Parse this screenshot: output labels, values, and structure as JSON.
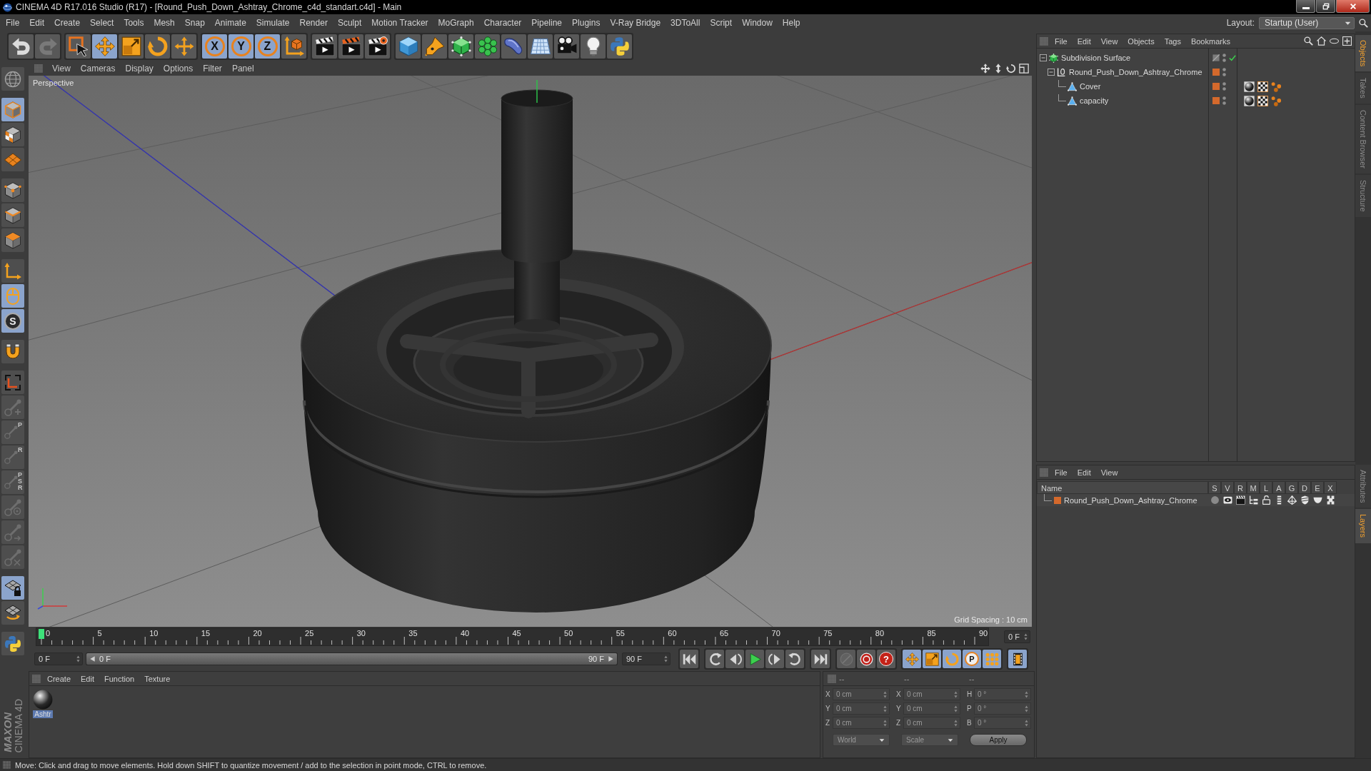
{
  "window": {
    "title": "CINEMA 4D R17.016 Studio (R17) - [Round_Push_Down_Ashtray_Chrome_c4d_standart.c4d] - Main"
  },
  "menu_bar": {
    "items": [
      "File",
      "Edit",
      "Create",
      "Select",
      "Tools",
      "Mesh",
      "Snap",
      "Animate",
      "Simulate",
      "Render",
      "Sculpt",
      "Motion Tracker",
      "MoGraph",
      "Character",
      "Pipeline",
      "Plugins",
      "V-Ray Bridge",
      "3DToAll",
      "Script",
      "Window",
      "Help"
    ],
    "layout_label": "Layout:",
    "layout_value": "Startup (User)"
  },
  "toolbar": {
    "groups": [
      [
        {
          "kind": "undo",
          "selected": false,
          "disabled": false
        },
        {
          "kind": "redo",
          "selected": false,
          "disabled": true
        }
      ],
      [
        {
          "kind": "select",
          "selected": false,
          "disabled": false
        },
        {
          "kind": "move",
          "selected": true,
          "disabled": false
        },
        {
          "kind": "scale",
          "selected": false,
          "disabled": false
        },
        {
          "kind": "rotate",
          "selected": false,
          "disabled": false
        },
        {
          "kind": "transform",
          "selected": false,
          "disabled": false
        }
      ],
      [
        {
          "kind": "axis",
          "label": "X",
          "selected": true,
          "disabled": false
        },
        {
          "kind": "axis",
          "label": "Y",
          "selected": true,
          "disabled": false
        },
        {
          "kind": "axis",
          "label": "Z",
          "selected": true,
          "disabled": false
        },
        {
          "kind": "coords",
          "selected": false,
          "disabled": false
        }
      ],
      [
        {
          "kind": "render",
          "selected": false,
          "disabled": false
        },
        {
          "kind": "renderview",
          "selected": false,
          "disabled": false
        },
        {
          "kind": "rendersettings",
          "selected": false,
          "disabled": false
        }
      ],
      [
        {
          "kind": "cube",
          "selected": false,
          "disabled": false
        },
        {
          "kind": "pen",
          "selected": false,
          "disabled": false
        },
        {
          "kind": "subdivision",
          "selected": false,
          "disabled": false
        },
        {
          "kind": "cloner",
          "selected": false,
          "disabled": false
        },
        {
          "kind": "deformer",
          "selected": false,
          "disabled": false
        },
        {
          "kind": "floor",
          "selected": false,
          "disabled": false
        },
        {
          "kind": "camera",
          "selected": false,
          "disabled": false
        },
        {
          "kind": "light",
          "selected": false,
          "disabled": false
        },
        {
          "kind": "python",
          "selected": false,
          "disabled": false
        }
      ]
    ]
  },
  "left_toolbar": {
    "groups": [
      [
        {
          "kind": "editable",
          "selected": false,
          "disabled": false
        }
      ],
      [
        {
          "kind": "model",
          "selected": true,
          "disabled": false
        },
        {
          "kind": "texture",
          "selected": false,
          "disabled": false
        },
        {
          "kind": "workplane",
          "selected": false,
          "disabled": false
        }
      ],
      [
        {
          "kind": "points",
          "selected": false,
          "disabled": false
        },
        {
          "kind": "edges",
          "selected": false,
          "disabled": false
        },
        {
          "kind": "polygons",
          "selected": false,
          "disabled": false
        }
      ],
      [
        {
          "kind": "laxis",
          "selected": false,
          "disabled": false
        },
        {
          "kind": "tweak",
          "selected": true,
          "disabled": false
        },
        {
          "kind": "snap",
          "label": "S",
          "selected": true,
          "disabled": false
        }
      ],
      [
        {
          "kind": "magnet",
          "selected": false,
          "disabled": false
        }
      ],
      [
        {
          "kind": "corner",
          "selected": false,
          "disabled": false
        },
        {
          "kind": "bonemove",
          "selected": false,
          "disabled": true
        },
        {
          "kind": "bone",
          "label": "P",
          "selected": false,
          "disabled": true
        },
        {
          "kind": "bone",
          "label": "R",
          "selected": false,
          "disabled": true
        },
        {
          "kind": "bone",
          "label": "PSR",
          "selected": false,
          "disabled": true
        },
        {
          "kind": "bonetarget",
          "selected": false,
          "disabled": true
        },
        {
          "kind": "bonearrow",
          "selected": false,
          "disabled": true
        },
        {
          "kind": "bonemirror",
          "selected": false,
          "disabled": true
        }
      ],
      [
        {
          "kind": "gridlock",
          "selected": true,
          "disabled": false
        },
        {
          "kind": "gridrotate",
          "selected": false,
          "disabled": false
        }
      ],
      [
        {
          "kind": "python",
          "selected": false,
          "disabled": false
        }
      ]
    ]
  },
  "viewport": {
    "menu": [
      "View",
      "Cameras",
      "Display",
      "Options",
      "Filter",
      "Panel"
    ],
    "camera": "Perspective",
    "grid_spacing": "Grid Spacing : 10 cm"
  },
  "timeline": {
    "ticks": [
      "0",
      "5",
      "10",
      "15",
      "20",
      "25",
      "30",
      "35",
      "40",
      "45",
      "50",
      "55",
      "60",
      "65",
      "70",
      "75",
      "80",
      "85",
      "90"
    ],
    "level": 0,
    "frame": "0 F"
  },
  "playback": {
    "start": "0 F",
    "range": {
      "start": "0 F",
      "end": "90 F",
      "level": 1
    },
    "end": "90 F",
    "groups": [
      [
        {
          "kind": "first",
          "selected": false,
          "disabled": false
        }
      ],
      [
        {
          "kind": "prevkey",
          "selected": false,
          "disabled": false
        },
        {
          "kind": "prevframe",
          "selected": false,
          "disabled": false
        },
        {
          "kind": "play",
          "selected": false,
          "disabled": false
        },
        {
          "kind": "nextframe",
          "selected": false,
          "disabled": false
        },
        {
          "kind": "nextkey",
          "selected": false,
          "disabled": false
        }
      ],
      [
        {
          "kind": "last",
          "selected": false,
          "disabled": false
        }
      ],
      [
        {
          "kind": "record",
          "selected": false,
          "disabled": true
        },
        {
          "kind": "autokey",
          "selected": false,
          "disabled": false
        },
        {
          "kind": "keyselection",
          "label": "?",
          "selected": false,
          "disabled": false
        }
      ],
      [
        {
          "kind": "keymove",
          "selected": true,
          "disabled": false
        },
        {
          "kind": "keyscale",
          "selected": true,
          "disabled": false
        },
        {
          "kind": "keyrotate",
          "selected": true,
          "disabled": false
        },
        {
          "kind": "keyparam",
          "label": "P",
          "selected": true,
          "disabled": false
        },
        {
          "kind": "keypoints",
          "selected": true,
          "disabled": false
        }
      ],
      [
        {
          "kind": "timeline",
          "selected": true,
          "disabled": false
        }
      ]
    ]
  },
  "material_manager": {
    "menu": [
      "Create",
      "Edit",
      "Function",
      "Texture"
    ],
    "materials": [
      {
        "name": "Ashtr",
        "selected": true
      }
    ]
  },
  "coordinates": {
    "headers": [
      "--",
      "--",
      "--"
    ],
    "rows": [
      {
        "cells": [
          {
            "label": "X",
            "value": "0 cm"
          },
          {
            "label": "X",
            "value": "0 cm"
          },
          {
            "label": "H",
            "value": "0 °"
          }
        ]
      },
      {
        "cells": [
          {
            "label": "Y",
            "value": "0 cm"
          },
          {
            "label": "Y",
            "value": "0 cm"
          },
          {
            "label": "P",
            "value": "0 °"
          }
        ]
      },
      {
        "cells": [
          {
            "label": "Z",
            "value": "0 cm"
          },
          {
            "label": "Z",
            "value": "0 cm"
          },
          {
            "label": "B",
            "value": "0 °"
          }
        ]
      }
    ],
    "coordinate_system": "World",
    "size_mode": "Scale",
    "apply": "Apply",
    "disabled": true
  },
  "brand": {
    "name": "MAXON",
    "product": "CINEMA 4D"
  },
  "object_manager": {
    "menu": [
      "File",
      "Edit",
      "View",
      "Objects",
      "Tags",
      "Bookmarks"
    ],
    "tree": [
      {
        "name": "Subdivision Surface",
        "kind": "subdivision",
        "expanded": true,
        "layer": false,
        "enabled": true,
        "children": [
          {
            "name": "Round_Push_Down_Ashtray_Chrome",
            "kind": "null",
            "expanded": true,
            "layer": true,
            "children": [
              {
                "name": "Cover",
                "kind": "polygon",
                "layer": true,
                "tags": [
                  {
                    "kind": "material"
                  },
                  {
                    "kind": "uvw"
                  },
                  {
                    "kind": "selection"
                  }
                ]
              },
              {
                "name": "capacity",
                "kind": "polygon",
                "layer": true,
                "tags": [
                  {
                    "kind": "material"
                  },
                  {
                    "kind": "uvw"
                  },
                  {
                    "kind": "selection"
                  }
                ]
              }
            ]
          }
        ]
      }
    ]
  },
  "layer_manager": {
    "menu": [
      "File",
      "Edit",
      "View"
    ],
    "columns": [
      "Name",
      "S",
      "V",
      "R",
      "M",
      "L",
      "A",
      "G",
      "D",
      "E",
      "X"
    ],
    "rows": [
      {
        "name": "Round_Push_Down_Ashtray_Chrome",
        "color": "#d4692c",
        "flags": [
          false,
          true,
          true,
          true,
          false,
          true,
          true,
          true,
          true,
          true
        ]
      }
    ]
  },
  "side_tabs": {
    "top": [
      {
        "label": "Objects",
        "selected": true
      },
      {
        "label": "Takes",
        "selected": false
      },
      {
        "label": "Content Browser",
        "selected": false
      },
      {
        "label": "Structure",
        "selected": false
      }
    ],
    "bottom": [
      {
        "label": "Attributes",
        "selected": false
      },
      {
        "label": "Layers",
        "selected": true
      }
    ]
  },
  "status_bar": {
    "text": "Move: Click and drag to move elements. Hold down SHIFT to quantize movement / add to the selection in point mode, CTRL to remove."
  }
}
